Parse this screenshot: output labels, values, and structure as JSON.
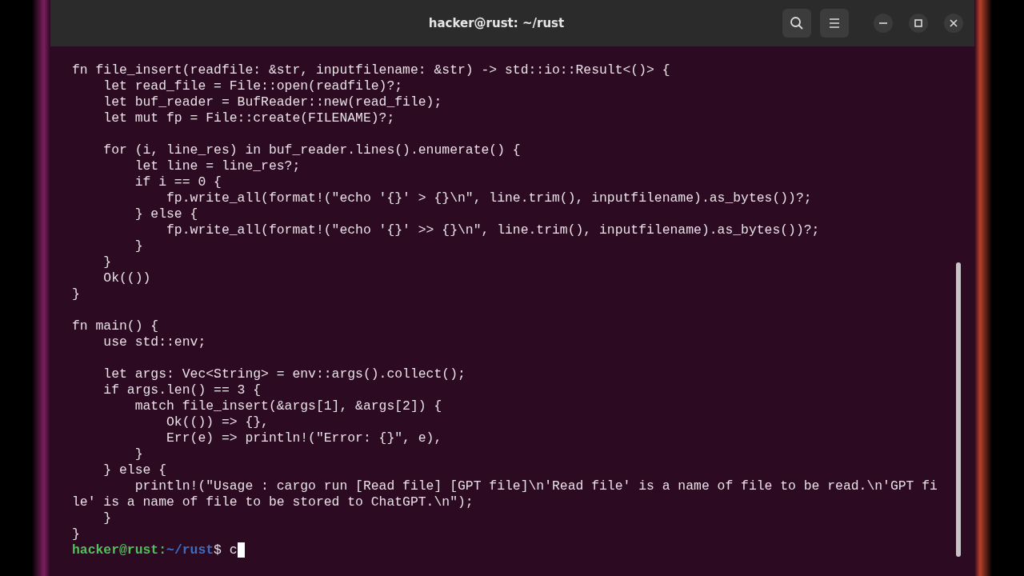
{
  "window": {
    "title": "hacker@rust: ~/rust"
  },
  "lines": [
    {
      "kind": "code",
      "text": "fn file_insert(readfile: &str, inputfilename: &str) -> std::io::Result<()> {"
    },
    {
      "kind": "code",
      "text": "    let read_file = File::open(readfile)?;"
    },
    {
      "kind": "code",
      "text": "    let buf_reader = BufReader::new(read_file);"
    },
    {
      "kind": "code",
      "text": "    let mut fp = File::create(FILENAME)?;"
    },
    {
      "kind": "blank"
    },
    {
      "kind": "code",
      "text": "    for (i, line_res) in buf_reader.lines().enumerate() {"
    },
    {
      "kind": "code",
      "text": "        let line = line_res?;"
    },
    {
      "kind": "code",
      "text": "        if i == 0 {"
    },
    {
      "kind": "code",
      "text": "            fp.write_all(format!(\"echo '{}' > {}\\n\", line.trim(), inputfilename).as_bytes())?;"
    },
    {
      "kind": "code",
      "text": "        } else {"
    },
    {
      "kind": "code",
      "text": "            fp.write_all(format!(\"echo '{}' >> {}\\n\", line.trim(), inputfilename).as_bytes())?;"
    },
    {
      "kind": "code",
      "text": "        }"
    },
    {
      "kind": "code",
      "text": "    }"
    },
    {
      "kind": "code",
      "text": "    Ok(())"
    },
    {
      "kind": "code",
      "text": "}"
    },
    {
      "kind": "blank"
    },
    {
      "kind": "code",
      "text": "fn main() {"
    },
    {
      "kind": "code",
      "text": "    use std::env;"
    },
    {
      "kind": "blank"
    },
    {
      "kind": "code",
      "text": "    let args: Vec<String> = env::args().collect();"
    },
    {
      "kind": "code",
      "text": "    if args.len() == 3 {"
    },
    {
      "kind": "code",
      "text": "        match file_insert(&args[1], &args[2]) {"
    },
    {
      "kind": "code",
      "text": "            Ok(()) => {},"
    },
    {
      "kind": "code",
      "text": "            Err(e) => println!(\"Error: {}\", e),"
    },
    {
      "kind": "code",
      "text": "        }"
    },
    {
      "kind": "code",
      "text": "    } else {"
    },
    {
      "kind": "code",
      "text": "        println!(\"Usage : cargo run [Read file] [GPT file]\\n'Read file' is a name of file to be read.\\n'GPT fi"
    },
    {
      "kind": "code",
      "text": "le' is a name of file to be stored to ChatGPT.\\n\");"
    },
    {
      "kind": "code",
      "text": "    }"
    },
    {
      "kind": "code",
      "text": "}"
    }
  ],
  "prompt": {
    "user_host": "hacker@rust",
    "separator": ":",
    "path": "~/rust",
    "symbol": "$",
    "input": "c"
  }
}
